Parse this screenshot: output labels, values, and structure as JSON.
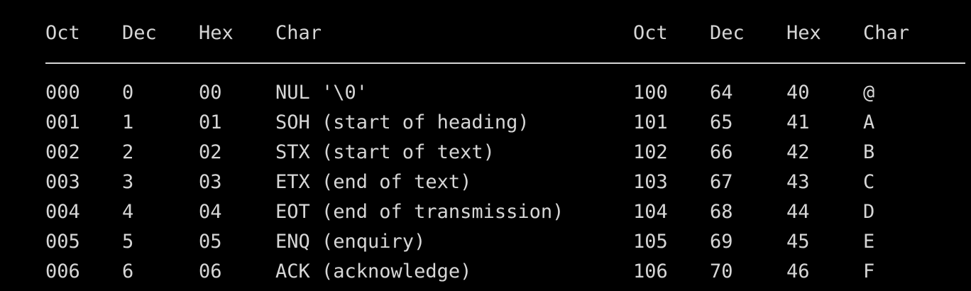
{
  "terminal": {
    "header": [
      "Oct",
      "Dec",
      "Hex",
      "Char",
      "Oct",
      "Dec",
      "Hex",
      "Char"
    ],
    "rows": [
      [
        "000",
        "0",
        "00",
        "NUL '\\0'",
        "100",
        "64",
        "40",
        "@"
      ],
      [
        "001",
        "1",
        "01",
        "SOH (start of heading)",
        "101",
        "65",
        "41",
        "A"
      ],
      [
        "002",
        "2",
        "02",
        "STX (start of text)",
        "102",
        "66",
        "42",
        "B"
      ],
      [
        "003",
        "3",
        "03",
        "ETX (end of text)",
        "103",
        "67",
        "43",
        "C"
      ],
      [
        "004",
        "4",
        "04",
        "EOT (end of transmission)",
        "104",
        "68",
        "44",
        "D"
      ],
      [
        "005",
        "5",
        "05",
        "ENQ (enquiry)",
        "105",
        "69",
        "45",
        "E"
      ],
      [
        "006",
        "6",
        "06",
        "ACK (acknowledge)",
        "106",
        "70",
        "46",
        "F"
      ]
    ],
    "colors": {
      "background": "#000000",
      "text": "#d6d6d6"
    }
  }
}
